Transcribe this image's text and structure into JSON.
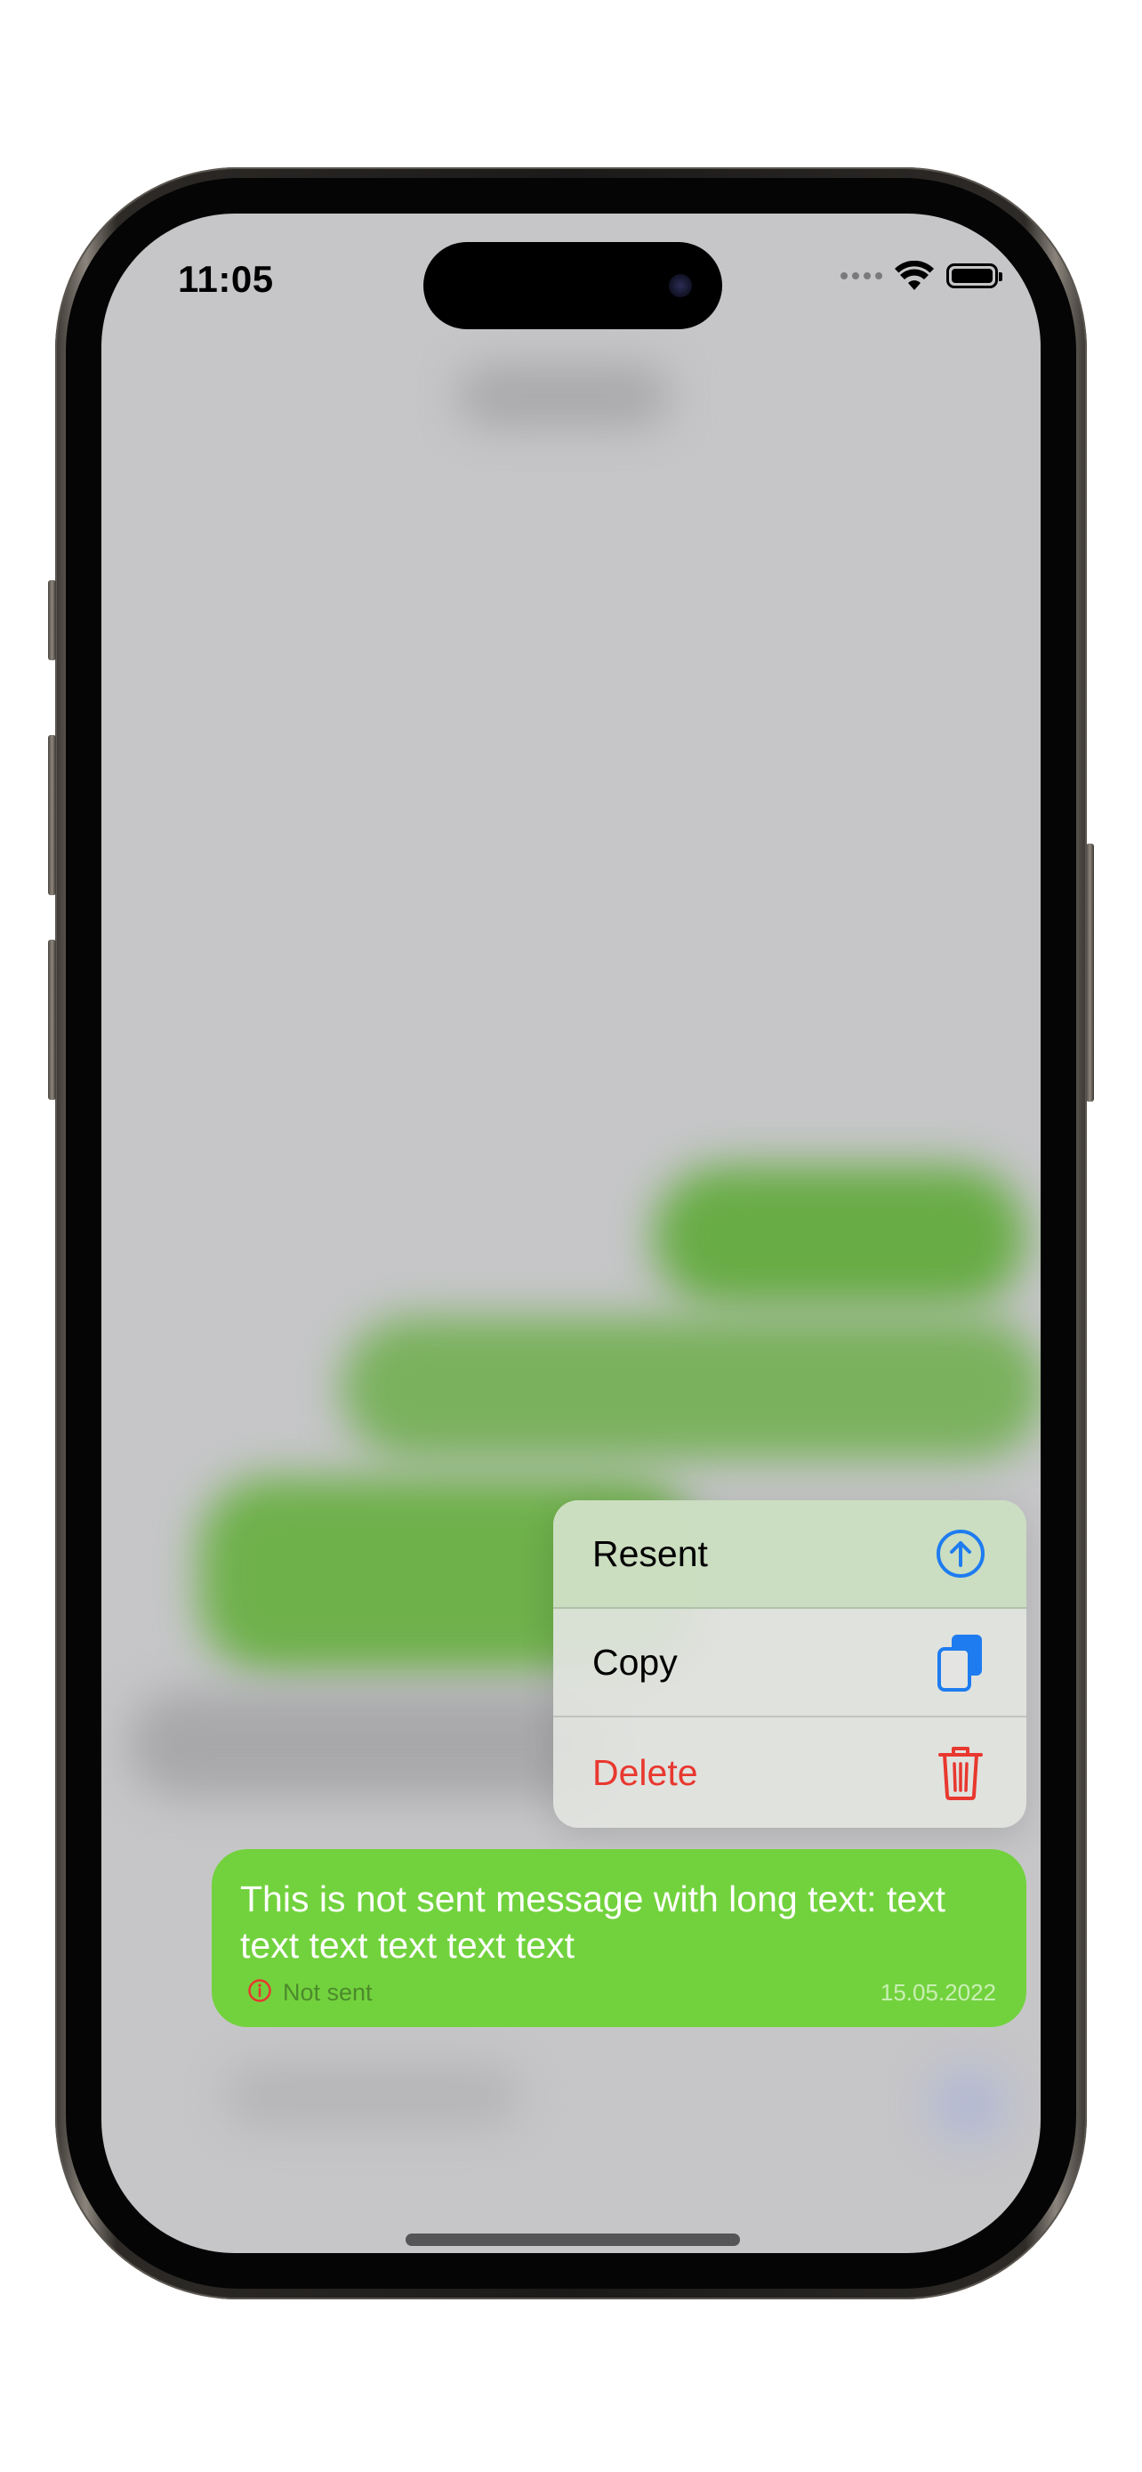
{
  "status_bar": {
    "time": "11:05"
  },
  "context_menu": {
    "items": [
      {
        "label": "Resent",
        "icon": "arrow-up-circle-icon",
        "color": "#000000",
        "icon_color": "#1e7cf0"
      },
      {
        "label": "Copy",
        "icon": "copy-icon",
        "color": "#000000",
        "icon_color": "#1e7cf0"
      },
      {
        "label": "Delete",
        "icon": "trash-icon",
        "color": "#e8382f",
        "icon_color": "#e8382f"
      }
    ]
  },
  "message": {
    "text": "This is not sent message with long text: text text text text text text",
    "status_text": "Not sent",
    "status_icon": "info-circle-icon",
    "timestamp": "15.05.2022",
    "bubble_color": "#72d23d"
  }
}
